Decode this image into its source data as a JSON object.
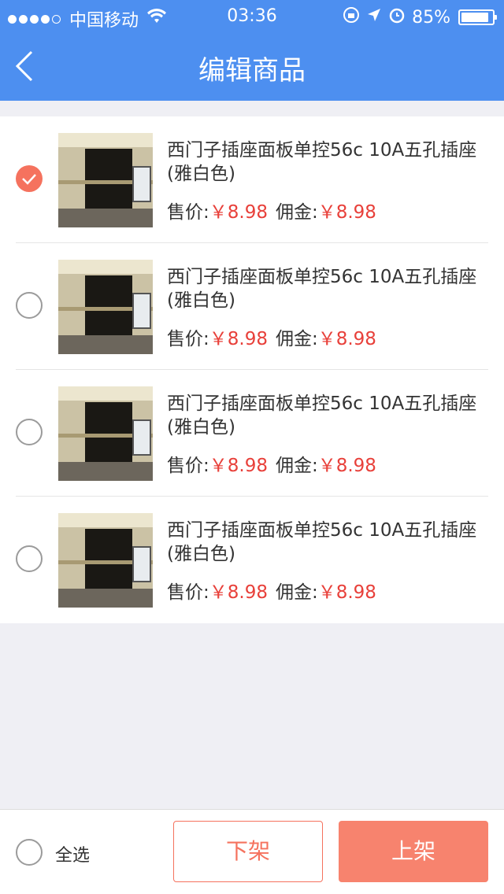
{
  "status_bar": {
    "carrier": "中国移动",
    "time": "03:36",
    "battery": "85%",
    "battery_level": 0.85,
    "signal_dots_filled": 4
  },
  "nav": {
    "title": "编辑商品",
    "back_icon": "chevron-left-icon"
  },
  "colors": {
    "primary_blue": "#4d8ff0",
    "accent": "#f5725e",
    "price_red": "#e8403a"
  },
  "products": [
    {
      "name": "西门子插座面板单控56c 10A五孔插座(雅白色)",
      "price_label": "售价:",
      "price": "￥8.98",
      "commission_label": "佣金:",
      "commission": "￥8.98",
      "checked": true
    },
    {
      "name": "西门子插座面板单控56c 10A五孔插座(雅白色)",
      "price_label": "售价:",
      "price": "￥8.98",
      "commission_label": "佣金:",
      "commission": "￥8.98",
      "checked": false
    },
    {
      "name": "西门子插座面板单控56c 10A五孔插座(雅白色)",
      "price_label": "售价:",
      "price": "￥8.98",
      "commission_label": "佣金:",
      "commission": "￥8.98",
      "checked": false
    },
    {
      "name": "西门子插座面板单控56c 10A五孔插座(雅白色)",
      "price_label": "售价:",
      "price": "￥8.98",
      "commission_label": "佣金:",
      "commission": "￥8.98",
      "checked": false
    }
  ],
  "footer": {
    "select_all_label": "全选",
    "unlist_label": "下架",
    "list_label": "上架"
  }
}
